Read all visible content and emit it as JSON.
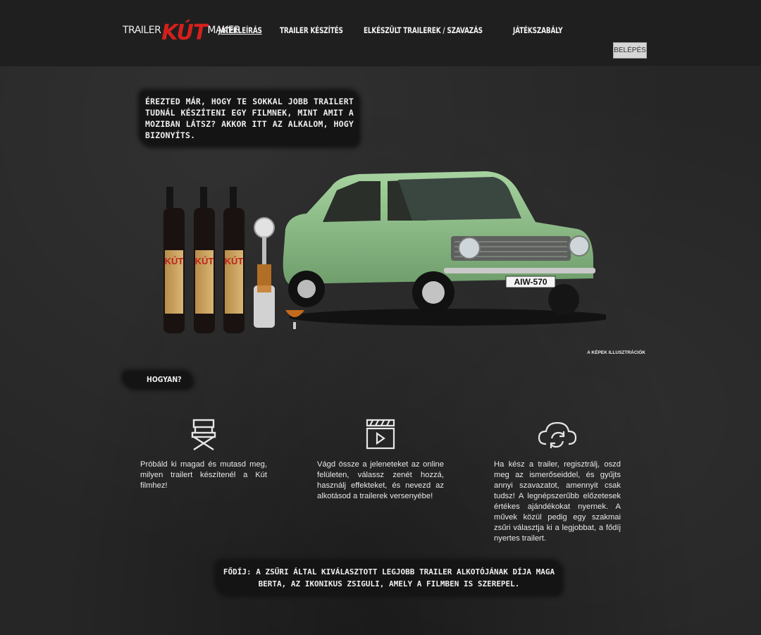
{
  "header": {
    "logo": {
      "left": "TRAILER",
      "mid": "KÚT",
      "right": "MAKER"
    },
    "nav": [
      {
        "label": "JÁTÉKLEÍRÁS",
        "active": true
      },
      {
        "label": "TRAILER KÉSZÍTÉS",
        "active": false
      },
      {
        "label": "ELKÉSZÜLT TRAILEREK / SZAVAZÁS",
        "active": false
      },
      {
        "label": "JÁTÉKSZABÁLY",
        "active": false
      }
    ],
    "login_label": "BELÉPÉS"
  },
  "intro": {
    "text": "ÉREZTED MÁR, HOGY TE SOKKAL JOBB TRAILERT TUDNÁL KÉSZÍTENI EGY FILMNEK, MINT AMIT A MOZIBAN LÁTSZ? AKKOR ITT AZ ALKALOM, HOGY BIZONYÍTS."
  },
  "product": {
    "plate": "AIW-570",
    "bottle_label": "KÚT",
    "bottle_variants": [
      "BARACK",
      "BARACK",
      "SZEDERES"
    ]
  },
  "image_caption": "A KÉPEK ILLUSZTRÁCIÓK",
  "how": {
    "title": "HOGYAN?",
    "steps": [
      {
        "icon": "directors-chair-icon",
        "text": "Próbáld ki magad és mutasd meg, milyen trailert készítenél a Kút filmhez!"
      },
      {
        "icon": "clapperboard-play-icon",
        "text": "Vágd össze a jeleneteket az online felületen, válassz zenét hozzá, használj effekteket, és nevezd az alkotásod a trailerek versenyébe!"
      },
      {
        "icon": "cloud-sync-icon",
        "text": "Ha kész a trailer, regisztrálj, oszd meg az ismerőseiddel, és gyűjts annyi szavazatot, amennyit csak tudsz! A legnépszerűbb előzetesek értékes ajándékokat nyernek. A művek közül pedig egy szakmai zsűri választja ki a legjobbat, a fődíj nyertes trailert."
      }
    ]
  },
  "prize": {
    "text": "FŐDÍJ: A ZSŰRI ÁLTAL KIVÁLASZTOTT LEGJOBB TRAILER ALKOTÓJÁNAK DÍJA MAGA BERTA, AZ IKONIKUS ZSIGULI, AMELY A FILMBEN IS SZEREPEL."
  },
  "colors": {
    "brand_red": "#d3201c",
    "car_green": "#8ec08a",
    "background": "#262626"
  }
}
